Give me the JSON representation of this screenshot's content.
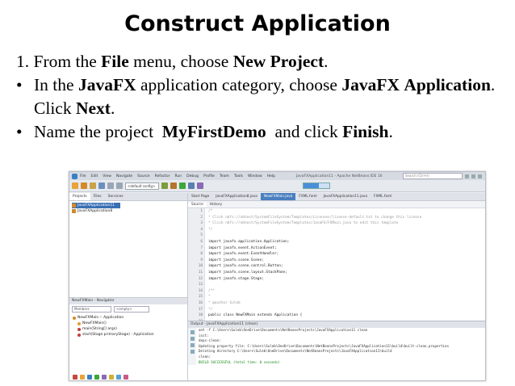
{
  "slide": {
    "title": "Construct Application",
    "step1": {
      "number": "1.",
      "pre": "From the ",
      "file": "File",
      "mid": " menu, choose ",
      "newproject": "New Project",
      "end": "."
    },
    "step2": {
      "bullet": "•",
      "pre": "In the ",
      "javafx": "JavaFX",
      "mid": " application category, choose ",
      "javafx2": "JavaFX",
      "application": "Application",
      "click": ". Click ",
      "next": "Next",
      "end": "."
    },
    "step3": {
      "bullet": "•",
      "pre": "Name the project  ",
      "project": "MyFirstDemo",
      "mid": "  and click ",
      "finish": "Finish",
      "end": "."
    }
  },
  "ide": {
    "menu": [
      "File",
      "Edit",
      "View",
      "Navigate",
      "Source",
      "Refactor",
      "Run",
      "Debug",
      "Profile",
      "Team",
      "Tools",
      "Window",
      "Help"
    ],
    "window_title": "JavaFXApplication11 - Apache NetBeans IDE 16",
    "search_placeholder": "Search (Ctrl+I)",
    "config": "<default config>",
    "left_tabs": [
      "Projects",
      "Files",
      "Services"
    ],
    "projects": [
      "JavaFXApplication11",
      "JavaFXApplication8"
    ],
    "navigator_title": "NewFXMain - Navigator",
    "navigator_members": "Members",
    "navigator_empty": "<empty>",
    "navigator_items": [
      "NewFXMain :: Application",
      "NewFXMain()",
      "main(String[] args)",
      "start(Stage primaryStage) : Application"
    ],
    "editor_tabs": [
      "Start Page",
      "JavaFXApplication8.java",
      "NewFXMain.java",
      "FXML.fxml",
      "JavaFXApplication11.java",
      "FXML.fxml"
    ],
    "editor_views": [
      "Source",
      "History"
    ],
    "line_numbers": [
      "1",
      "2",
      "3",
      "4",
      "5",
      "6",
      "7",
      "8",
      "9",
      "10",
      "11",
      "12",
      "13",
      "14",
      "15",
      "16",
      "17",
      "18",
      "19",
      "20",
      "21"
    ],
    "code_lines": [
      "/*",
      " * Click nbfs://nbhost/SystemFileSystem/Templates/Licenses/license-default.txt to change this license",
      " * Click nbfs://nbhost/SystemFileSystem/Templates/JavaFX/FXMain.java to edit this template",
      " */",
      "",
      "import javafx.application.Application;",
      "import javafx.event.ActionEvent;",
      "import javafx.event.EventHandler;",
      "import javafx.scene.Scene;",
      "import javafx.scene.control.Button;",
      "import javafx.scene.layout.StackPane;",
      "import javafx.stage.Stage;",
      "",
      "/**",
      " *",
      " * @author Suleb",
      " */",
      "public class NewFXMain extends Application {",
      "",
      "    @Override",
      ""
    ],
    "output_title": "Output - JavaFXApplication11 (clean)",
    "output_lines": [
      "ant -f C:\\Users\\Suleb\\OneDrive\\Documents\\NetBeansProjects\\JavaFXApplication11 clean",
      "init:",
      "deps-clean:",
      "Updating property file: C:\\Users\\Suleb\\OneDrive\\Documents\\NetBeansProjects\\JavaFXApplication11\\build\\built-clean.properties",
      "Deleting directory C:\\Users\\Suleb\\OneDrive\\Documents\\NetBeansProjects\\JavaFXApplication11\\build",
      "clean:",
      "BUILD SUCCESSFUL (total time: 0 seconds)"
    ]
  }
}
